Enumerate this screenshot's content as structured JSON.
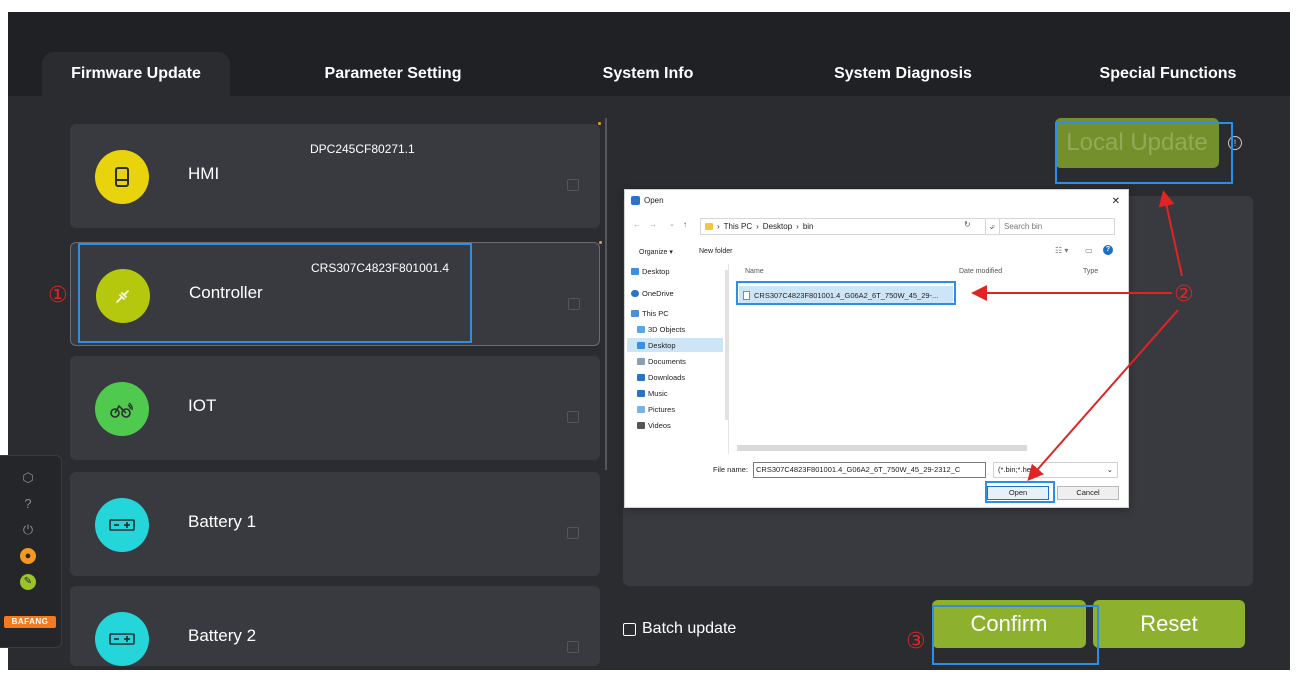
{
  "tabs": [
    {
      "label": "Firmware Update"
    },
    {
      "label": "Parameter Setting"
    },
    {
      "label": "System Info"
    },
    {
      "label": "System Diagnosis"
    },
    {
      "label": "Special Functions"
    }
  ],
  "devices": [
    {
      "name": "HMI",
      "version": "DPC245CF80271.1",
      "color": "#e8d30d"
    },
    {
      "name": "Controller",
      "version": "CRS307C4823F801001.4",
      "color": "#b6c80e"
    },
    {
      "name": "IOT",
      "version": "",
      "color": "#4fca4e"
    },
    {
      "name": "Battery 1",
      "version": "",
      "color": "#24d5d9"
    },
    {
      "name": "Battery 2",
      "version": "",
      "color": "#24d5d9"
    }
  ],
  "actions": {
    "local_update": "Local Update",
    "batch_update": "Batch update",
    "confirm": "Confirm",
    "reset": "Reset"
  },
  "rail": {
    "brand": "BAFANG"
  },
  "annotations": {
    "step1": "①",
    "step2": "②",
    "step3": "③"
  },
  "dialog": {
    "title": "Open",
    "breadcrumb": [
      "This PC",
      "Desktop",
      "bin"
    ],
    "search_placeholder": "Search bin",
    "toolbar": {
      "organize": "Organize ▾",
      "new_folder": "New folder"
    },
    "sidebar": [
      {
        "label": "Desktop",
        "color": "#3d8ee6"
      },
      {
        "label": "OneDrive",
        "color": "#2a73c9"
      },
      {
        "label": "This PC",
        "color": "#4a90d9"
      },
      {
        "label": "3D Objects",
        "color": "#5aa7e8"
      },
      {
        "label": "Desktop",
        "color": "#3d8ee6"
      },
      {
        "label": "Documents",
        "color": "#8aa0b8"
      },
      {
        "label": "Downloads",
        "color": "#2a73c9"
      },
      {
        "label": "Music",
        "color": "#2a73c9"
      },
      {
        "label": "Pictures",
        "color": "#7cb1e0"
      },
      {
        "label": "Videos",
        "color": "#555555"
      }
    ],
    "columns": {
      "name": "Name",
      "date": "Date modified",
      "type": "Type"
    },
    "file": "CRS307C4823F801001.4_G06A2_6T_750W_45_29-...",
    "file_name_label": "File name:",
    "file_name_value": "CRS307C4823F801001.4_G06A2_6T_750W_45_29-2312_C",
    "file_type": "(*.bin;*.hex)",
    "open_label": "Open",
    "cancel_label": "Cancel"
  },
  "colors": {
    "accent_green": "#8db02e",
    "annotation_red": "#e02424",
    "annotation_blue": "#2b8fe6"
  }
}
